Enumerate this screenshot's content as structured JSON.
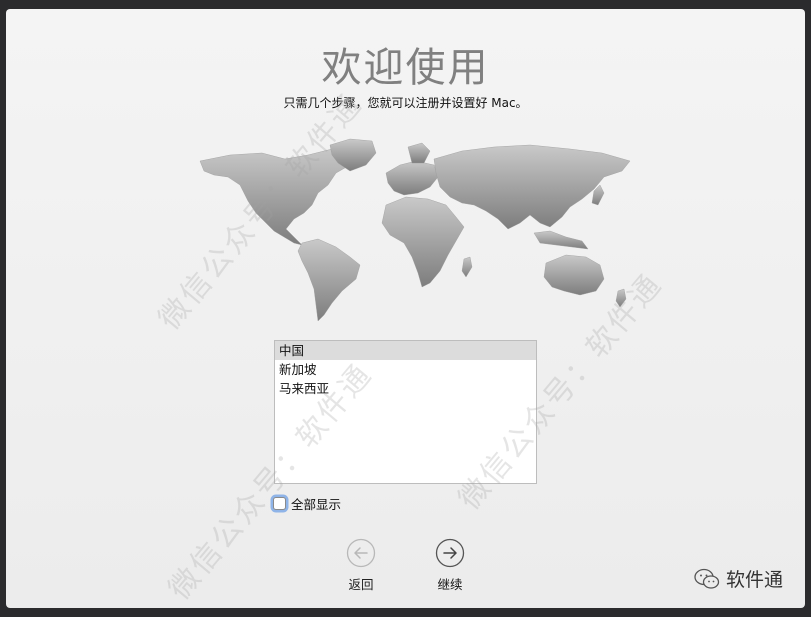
{
  "welcome": {
    "title": "欢迎使用",
    "subtitle": "只需几个步骤，您就可以注册并设置好 Mac。"
  },
  "country_list": {
    "items": [
      {
        "label": "中国",
        "selected": true
      },
      {
        "label": "新加坡",
        "selected": false
      },
      {
        "label": "马来西亚",
        "selected": false
      }
    ]
  },
  "show_all": {
    "label": "全部显示",
    "checked": false
  },
  "nav": {
    "back_label": "返回",
    "continue_label": "继续"
  },
  "watermark": {
    "text": "微信公众号：软件通"
  },
  "brand": {
    "label": "软件通"
  },
  "colors": {
    "checkbox_focus": "#8fb4e8",
    "selected_row": "#dcdcdc",
    "map_gray": "#8c8c8c"
  },
  "icons": {
    "back": "arrow-left-circle-icon",
    "continue": "arrow-right-circle-icon",
    "brand": "wechat-icon"
  }
}
